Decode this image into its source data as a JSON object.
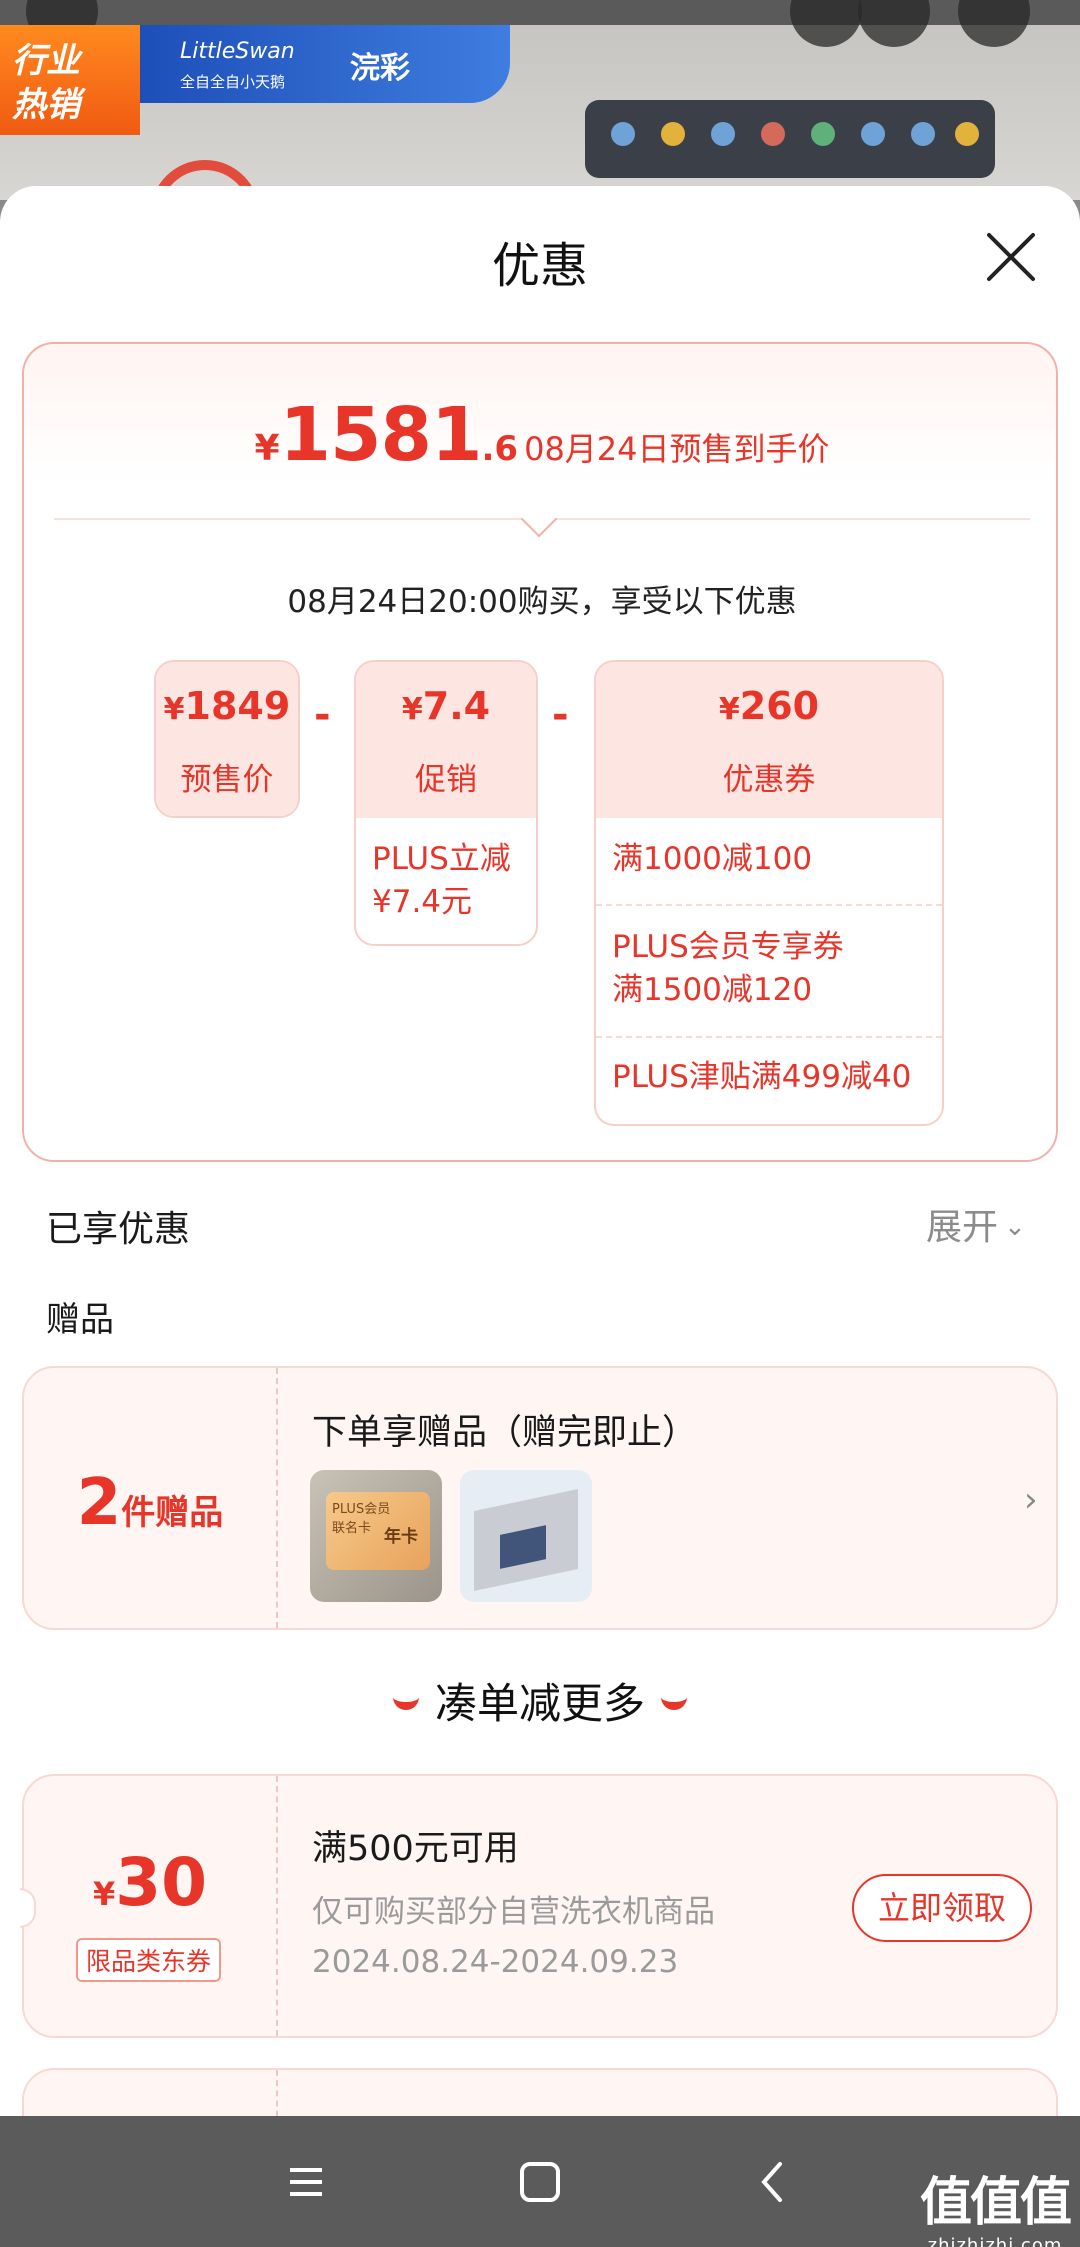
{
  "background": {
    "hot_badge": "行业\n热销",
    "brand_name": "LittleSwan",
    "brand_sub": "全自全自小天鹅",
    "brand_logo": "浣彩"
  },
  "sheet": {
    "title": "优惠"
  },
  "price_summary": {
    "currency": "¥",
    "integer": "1581",
    "decimal": ".6",
    "label": "08月24日预售到手价",
    "buy_time": "08月24日20:00购买，享受以下优惠",
    "minus_symbol": "-",
    "presale": {
      "currency": "¥",
      "amount": "1849",
      "label": "预售价"
    },
    "promotion": {
      "currency": "¥",
      "amount": "7.4",
      "label": "促销",
      "details": [
        "PLUS立减\n¥7.4元"
      ]
    },
    "coupon": {
      "currency": "¥",
      "amount": "260",
      "label": "优惠券",
      "details": [
        "满1000减100",
        "PLUS会员专享券\n满1500减120",
        "PLUS津贴满499减40"
      ]
    }
  },
  "enjoyed": {
    "label": "已享优惠",
    "expand_label": "展开"
  },
  "gifts": {
    "section_label": "赠品",
    "count": "2",
    "count_unit": "件赠品",
    "title": "下单享赠品（赠完即止）",
    "thumb1_text": "PLUS会员\n联名卡",
    "thumb1_badge": "年卡"
  },
  "more": {
    "title": "凑单减更多"
  },
  "coupon_offer": {
    "currency": "¥",
    "amount": "30",
    "tag": "限品类东券",
    "condition": "满500元可用",
    "scope": "仅可购买部分自营洗衣机商品",
    "validity": "2024.08.24-2024.09.23",
    "claim_label": "立即领取"
  },
  "watermark": {
    "main": "值值值",
    "sub": "zhizhizhi.com"
  },
  "colors": {
    "accent": "#e8352a",
    "tint": "#fde6e1"
  }
}
